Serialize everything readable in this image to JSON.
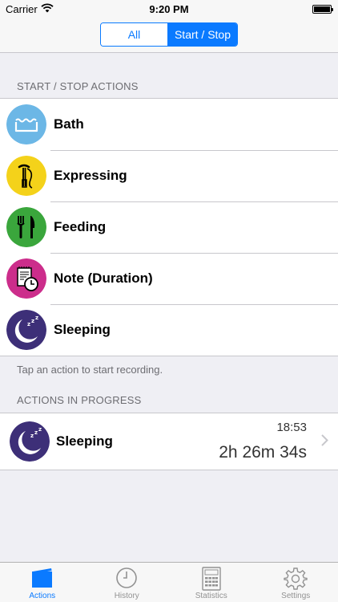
{
  "status": {
    "carrier": "Carrier",
    "time": "9:20 PM"
  },
  "segments": {
    "all": "All",
    "start_stop": "Start / Stop"
  },
  "start_stop_section": {
    "header": "START / STOP ACTIONS",
    "items": [
      {
        "label": "Bath",
        "icon": "bath-icon",
        "color": "#6cb7e6"
      },
      {
        "label": "Expressing",
        "icon": "breast-pump-icon",
        "color": "#f4d21a"
      },
      {
        "label": "Feeding",
        "icon": "fork-knife-icon",
        "color": "#3aa63c"
      },
      {
        "label": "Note (Duration)",
        "icon": "note-clock-icon",
        "color": "#cc2d8b"
      },
      {
        "label": "Sleeping",
        "icon": "moon-zzz-icon",
        "color": "#3d2f78"
      }
    ],
    "footer": "Tap an action to start recording."
  },
  "in_progress_section": {
    "header": "ACTIONS IN PROGRESS",
    "items": [
      {
        "label": "Sleeping",
        "icon": "moon-zzz-icon",
        "time": "18:53",
        "duration": "2h 26m 34s"
      }
    ]
  },
  "tabs": [
    {
      "label": "Actions",
      "icon": "actions-tab-icon",
      "active": true
    },
    {
      "label": "History",
      "icon": "clock-icon",
      "active": false
    },
    {
      "label": "Statistics",
      "icon": "calculator-icon",
      "active": false
    },
    {
      "label": "Settings",
      "icon": "gear-icon",
      "active": false
    }
  ],
  "colors": {
    "accent": "#0a7aff",
    "background": "#efeff4"
  }
}
